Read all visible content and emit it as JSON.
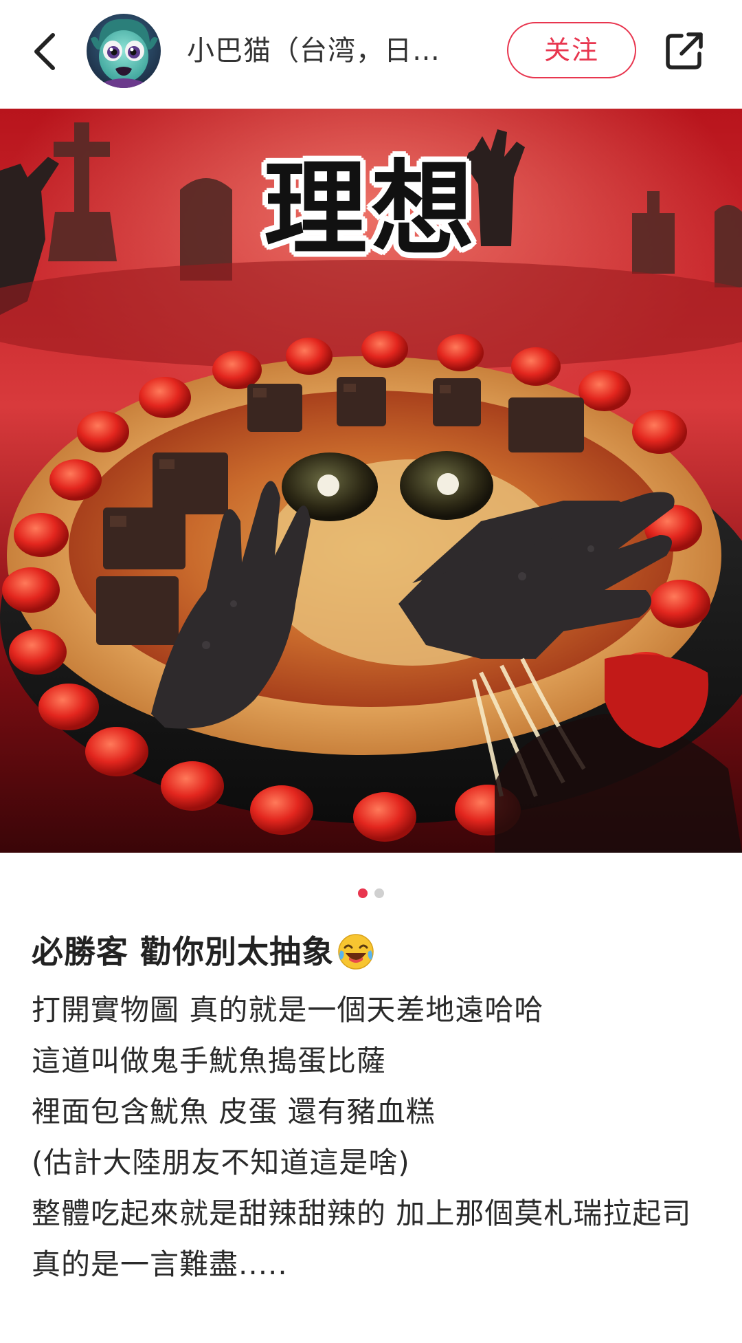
{
  "header": {
    "back_icon": "chevron-left-icon",
    "author_name": "小巴猫（台湾，日…",
    "follow_label": "关注",
    "share_icon": "share-external-icon",
    "accent_color": "#e8364f"
  },
  "carousel": {
    "overlay_text": "理想",
    "current_index": 1,
    "total": 2
  },
  "post": {
    "title": "必勝客 勸你別太抽象",
    "title_emoji": "laughing-crying-emoji",
    "lines": [
      "打開實物圖 真的就是一個天差地遠哈哈",
      "這道叫做鬼手魷魚搗蛋比薩",
      "裡面包含魷魚 皮蛋 還有豬血糕",
      "(估計大陸朋友不知道這是啥)",
      "整體吃起來就是甜辣甜辣的 加上那個莫札瑞拉起司",
      "真的是一言難盡....."
    ]
  }
}
